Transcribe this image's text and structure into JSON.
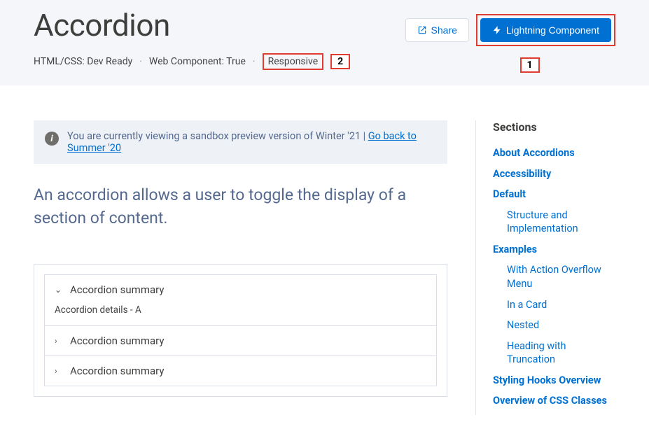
{
  "header": {
    "title": "Accordion",
    "meta": {
      "html_css": "HTML/CSS: Dev Ready",
      "web_component": "Web Component: True",
      "responsive": "Responsive"
    },
    "actions": {
      "share": "Share",
      "lightning": "Lightning Component"
    },
    "callouts": {
      "one": "1",
      "two": "2"
    }
  },
  "info": {
    "text_prefix": "You are currently viewing a sandbox preview version of Winter '21 | ",
    "link": "Go back to Summer '20"
  },
  "intro": "An accordion allows a user to toggle the display of a section of content.",
  "accordion": {
    "items": [
      {
        "summary": "Accordion summary",
        "details": "Accordion details - A",
        "open": true
      },
      {
        "summary": "Accordion summary",
        "open": false
      },
      {
        "summary": "Accordion summary",
        "open": false
      }
    ]
  },
  "sidebar": {
    "title": "Sections",
    "links": [
      {
        "label": "About Accordions",
        "bold": true
      },
      {
        "label": "Accessibility",
        "bold": true
      },
      {
        "label": "Default",
        "bold": true
      },
      {
        "label": "Structure and Implementation",
        "sub": true
      },
      {
        "label": "Examples",
        "bold": true
      },
      {
        "label": "With Action Overflow Menu",
        "sub": true
      },
      {
        "label": "In a Card",
        "sub": true
      },
      {
        "label": "Nested",
        "sub": true
      },
      {
        "label": "Heading with Truncation",
        "sub": true
      },
      {
        "label": "Styling Hooks Overview",
        "bold": true
      },
      {
        "label": "Overview of CSS Classes",
        "bold": true
      }
    ]
  }
}
